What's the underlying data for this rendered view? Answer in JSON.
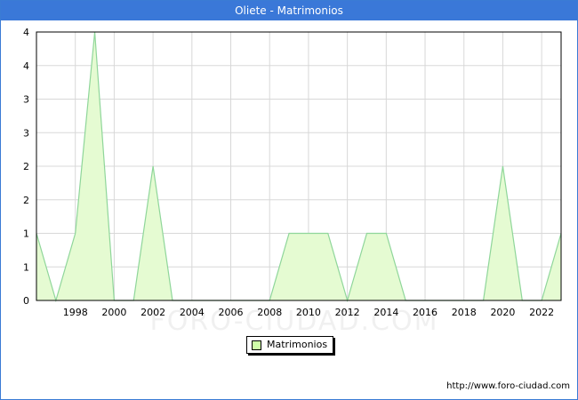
{
  "header": {
    "title": "Oliete - Matrimonios"
  },
  "watermark": "FORO-CIUDAD.COM",
  "source_url": "http://www.foro-ciudad.com",
  "colors": {
    "title_bar": "#3a78d8",
    "area_fill": "#e5fbd2",
    "area_stroke": "#8fd69a",
    "grid": "#d8d8d8",
    "legend_swatch": "#cfffa8"
  },
  "chart_data": {
    "type": "area",
    "title": "Oliete - Matrimonios",
    "xlabel": "",
    "ylabel": "",
    "x": [
      1996,
      1997,
      1998,
      1999,
      2000,
      2001,
      2002,
      2003,
      2004,
      2005,
      2006,
      2007,
      2008,
      2009,
      2010,
      2011,
      2012,
      2013,
      2014,
      2015,
      2016,
      2017,
      2018,
      2019,
      2020,
      2021,
      2022,
      2023
    ],
    "series": [
      {
        "name": "Matrimonios",
        "values": [
          1,
          0,
          1,
          4,
          0,
          0,
          2,
          0,
          0,
          0,
          0,
          0,
          0,
          1,
          1,
          1,
          0,
          1,
          1,
          0,
          0,
          0,
          0,
          0,
          2,
          0,
          0,
          1
        ]
      }
    ],
    "xlim": [
      1996,
      2023
    ],
    "ylim": [
      0,
      4
    ],
    "x_ticks": [
      "1998",
      "2000",
      "2002",
      "2004",
      "2006",
      "2008",
      "2010",
      "2012",
      "2014",
      "2016",
      "2018",
      "2020",
      "2022"
    ],
    "y_ticks": [
      "0",
      "1",
      "1",
      "2",
      "2",
      "3",
      "3",
      "4",
      "4"
    ],
    "grid": true,
    "legend": {
      "position": "bottom-center",
      "entries": [
        "Matrimonios"
      ]
    }
  }
}
